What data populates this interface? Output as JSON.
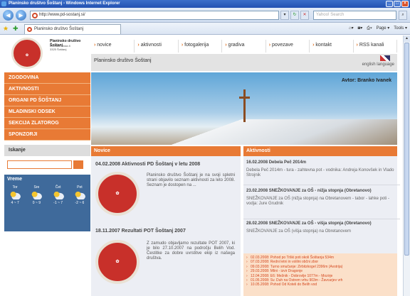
{
  "browser": {
    "window_title": "Planinsko društvo Šoštanj - Windows Internet Explorer",
    "url": "http://www.pd-sostanj.si/",
    "search_placeholder": "Yahoo! Search",
    "tab_title": "Planinsko društvo Šoštanj",
    "tools": {
      "page": "Page",
      "tools": "Tools"
    }
  },
  "site": {
    "org_name": "Planinsko društvo Šoštanj",
    "org_address_1": "Koroška cesta 8",
    "org_address_2": "3325 Šoštanj",
    "nav": [
      "novice",
      "aktivnosti",
      "fotogalerija",
      "gradiva",
      "povezave",
      "kontakt",
      "RSS kanali"
    ],
    "subtitle": "Planinsko društvo Šoštanj",
    "english": "english language",
    "menu": [
      "ZGODOVINA",
      "AKTIVNOSTI",
      "ORGANI PD ŠOŠTANJ",
      "MLADINSKI ODSEK",
      "SEKCIJA ZLATOROG",
      "SPONZORJI"
    ],
    "search_title": "Iskanje",
    "weather": {
      "title": "Vreme",
      "days": [
        {
          "day": "Tor",
          "temp": "4 ~ 7"
        },
        {
          "day": "Sre",
          "temp": "0 ~ 9"
        },
        {
          "day": "Čet",
          "temp": "-1 ~ 7"
        },
        {
          "day": "Pet",
          "temp": "-2 ~ 6"
        }
      ]
    },
    "banner_author": "Avtor: Branko Ivanek",
    "logo_text": "Planinsko društvo Šoštanj",
    "logo_year_left": "19",
    "logo_year_right": "04",
    "news": {
      "header": "Novice",
      "items": [
        {
          "title": "04.02.2008 Aktivnosti PD Šoštanj v letu 2008",
          "text": "Planinsko društvo Šoštanj je na svoji spletni strani objavilo seznam aktivnosti za leto 2008. Seznam je dostopen na ..."
        },
        {
          "title": "18.11.2007 Rezultati POT Šoštanj 2007",
          "text": "Z zamudo objavljamo rezultate POT 2007, ki je bilo 27.10.2007 na področju Belih Vod. Čestitke za dobre uvrstitve ekip iz našega društva."
        }
      ]
    },
    "activities": {
      "header": "Aktivnosti",
      "items": [
        {
          "title": "16.02.2008 Debela Peč 2014m",
          "text": "Debela Peč 2014m - tura - zahtevna pot - vodnika: Andreja Konovšek in Vlado Strojnik"
        },
        {
          "title": "23.02.2008 SNEŽKOVANJE za OŠ - nižja stopnja (Obretanovo)",
          "text": "SNEŽKOVANJE za OŠ (nižja stopnja) na Obretanovem - tabor - lahke poti - vodja: Jure Grudnik"
        },
        {
          "title": "28.02.2008 SNEŽKOVANJE za OŠ - višja stopnja (Obretanovo)",
          "text": "SNEŽKOVANJE za OŠ (višja stopnja) na Obretanovem"
        }
      ],
      "events": [
        "02.03.2008: Pohod po Trški poti okoli Šoštanja 534m",
        "07.03.2008: Redni letni in volilni občni zbor",
        "09.03.2008: Turno smučanje: Zirbitzkogel 2396m (Avstrija)",
        "29.03.2008: Mlini - izvir Dragonje",
        "12.04.2008: E6: Mežnik - Dobrovlje 1077m - Mozirje",
        "01.05.2008: Sv. Duh na Ostrem vrhu 903m - Žavcarjev vrh",
        "10.05.2008: Pohod Od Koteli do Belih vod"
      ]
    }
  }
}
